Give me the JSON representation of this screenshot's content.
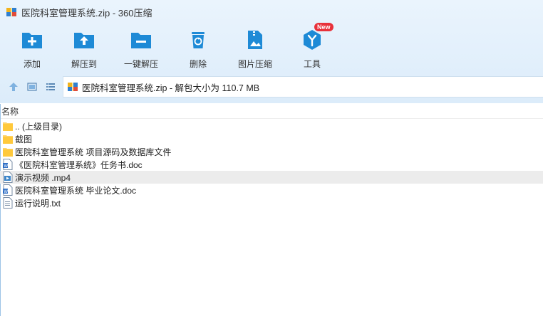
{
  "window": {
    "title": "医院科室管理系统.zip - 360压缩"
  },
  "toolbar": {
    "items": [
      {
        "label": "添加",
        "icon": "add-folder-icon"
      },
      {
        "label": "解压到",
        "icon": "extract-to-icon"
      },
      {
        "label": "一键解压",
        "icon": "one-click-extract-icon"
      },
      {
        "label": "删除",
        "icon": "delete-icon"
      },
      {
        "label": "图片压缩",
        "icon": "image-compress-icon"
      },
      {
        "label": "工具",
        "icon": "tools-icon",
        "badge": "New"
      }
    ]
  },
  "pathbar": {
    "path_text": "医院科室管理系统.zip - 解包大小为 110.7 MB"
  },
  "list": {
    "header": "名称",
    "rows": [
      {
        "name": ".. (上级目录)",
        "type": "folder"
      },
      {
        "name": "截图",
        "type": "folder"
      },
      {
        "name": "医院科室管理系统 项目源码及数据库文件",
        "type": "folder"
      },
      {
        "name": "《医院科室管理系统》任务书.doc",
        "type": "doc"
      },
      {
        "name": "演示视频 .mp4",
        "type": "video"
      },
      {
        "name": "医院科室管理系统 毕业论文.doc",
        "type": "doc"
      },
      {
        "name": "运行说明.txt",
        "type": "txt"
      }
    ],
    "selected_index": 4
  },
  "colors": {
    "accent": "#1e8ad6",
    "folder": "#ffd46b",
    "badge": "#e8313a"
  }
}
